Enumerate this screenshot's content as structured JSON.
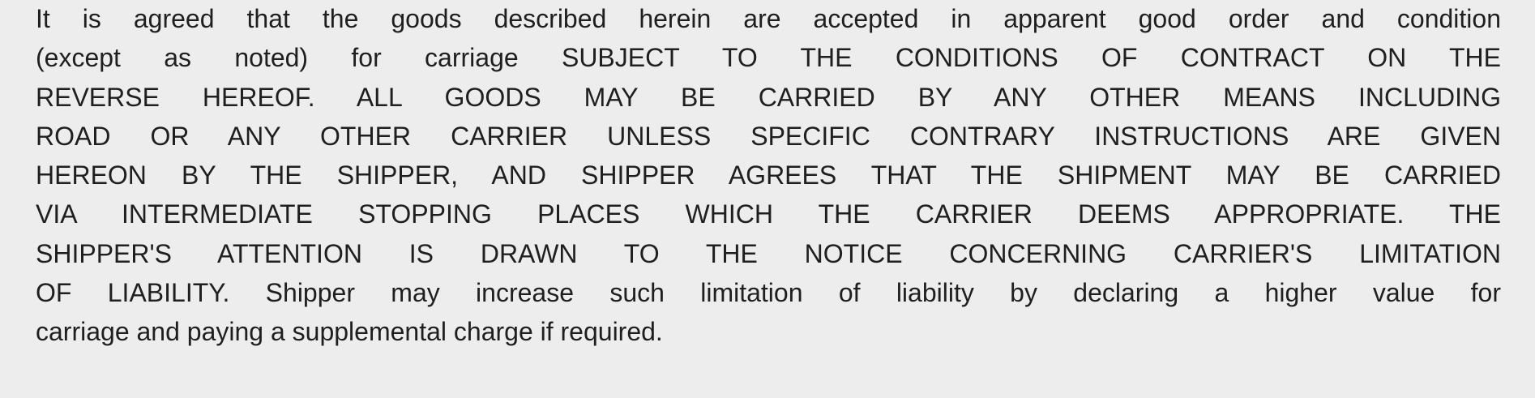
{
  "document": {
    "conditions_of_carriage": [
      "It is agreed that the goods described herein are accepted in apparent good order and condition",
      "(except as noted) for carriage SUBJECT TO THE CONDITIONS OF CONTRACT ON THE",
      "REVERSE HEREOF. ALL GOODS MAY BE CARRIED BY ANY OTHER MEANS INCLUDING",
      "ROAD OR ANY OTHER CARRIER UNLESS SPECIFIC CONTRARY INSTRUCTIONS ARE GIVEN",
      "HEREON BY THE SHIPPER, AND SHIPPER AGREES THAT THE SHIPMENT MAY BE CARRIED",
      "VIA INTERMEDIATE STOPPING PLACES WHICH THE CARRIER DEEMS APPROPRIATE.  THE",
      "SHIPPER'S ATTENTION IS DRAWN TO THE NOTICE CONCERNING CARRIER'S LIMITATION",
      "OF LIABILITY.  Shipper may increase such limitation of liability by declaring a higher value for",
      "carriage and paying a supplemental charge if required."
    ]
  }
}
